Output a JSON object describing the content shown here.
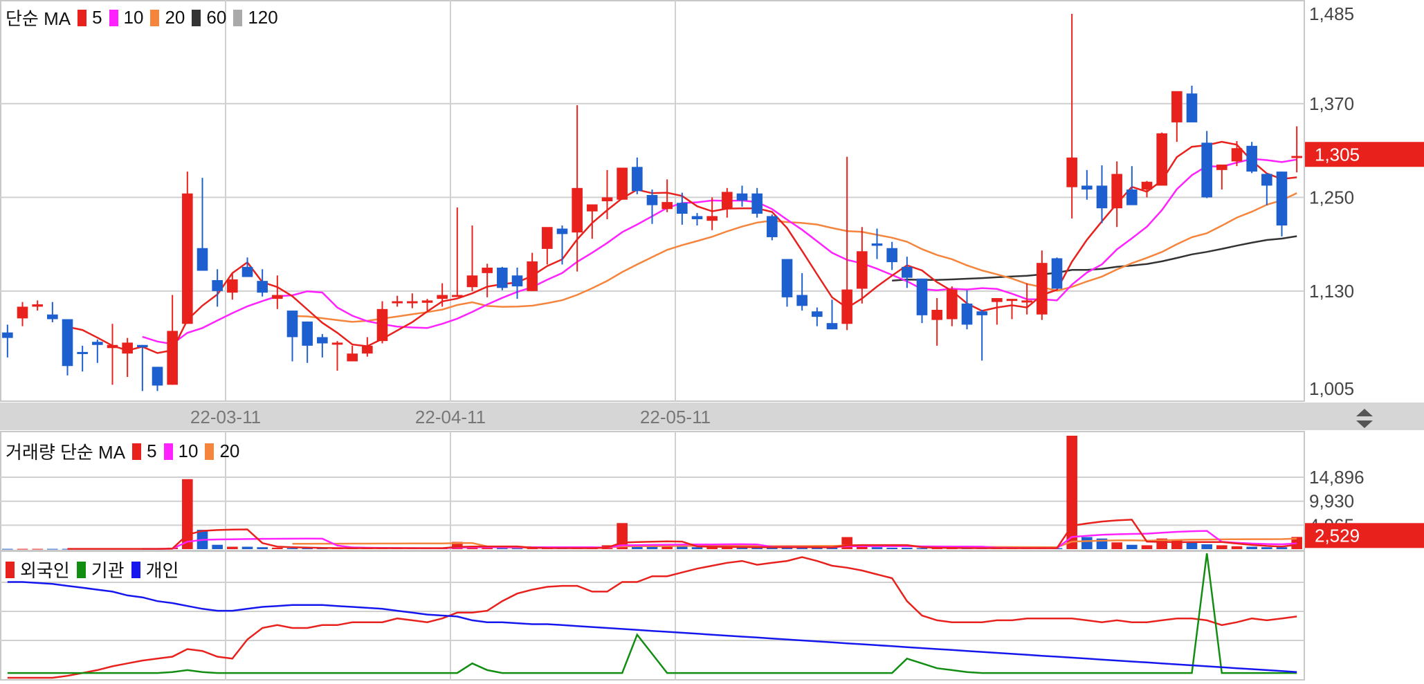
{
  "chart_data": [
    {
      "type": "candlestick",
      "legend": {
        "title": "단순 MA",
        "items": [
          {
            "label": "5",
            "color": "#e8211d"
          },
          {
            "label": "10",
            "color": "#ff22ff"
          },
          {
            "label": "20",
            "color": "#f5843c"
          },
          {
            "label": "60",
            "color": "#333333"
          },
          {
            "label": "120",
            "color": "#aaaaaa"
          }
        ]
      },
      "y_ticks": [
        "1,485",
        "1,370",
        "1,250",
        "1,130",
        "1,005"
      ],
      "ylim": [
        1005,
        1485
      ],
      "current_price": "1,305",
      "x_ticks": [
        "22-03-11",
        "22-04-11",
        "22-05-11"
      ],
      "up_color": "#e8211d",
      "down_color": "#1d5fcf",
      "candles": [
        [
          1077,
          1087,
          1045,
          1070
        ],
        [
          1095,
          1116,
          1085,
          1110
        ],
        [
          1110,
          1118,
          1105,
          1113
        ],
        [
          1100,
          1116,
          1090,
          1094
        ],
        [
          1094,
          1094,
          1022,
          1034
        ],
        [
          1052,
          1060,
          1027,
          1050
        ],
        [
          1065,
          1068,
          1038,
          1061
        ],
        [
          1057,
          1088,
          1010,
          1061
        ],
        [
          1050,
          1070,
          1020,
          1064
        ],
        [
          1061,
          1061,
          1002,
          1058
        ],
        [
          1033,
          1033,
          1002,
          1009
        ],
        [
          1010,
          1125,
          1010,
          1079
        ],
        [
          1088,
          1283,
          1088,
          1255
        ],
        [
          1185,
          1275,
          1160,
          1156
        ],
        [
          1144,
          1158,
          1110,
          1130
        ],
        [
          1128,
          1153,
          1119,
          1145
        ],
        [
          1161,
          1173,
          1150,
          1148
        ],
        [
          1143,
          1158,
          1123,
          1128
        ],
        [
          1120,
          1150,
          1107,
          1125
        ],
        [
          1105,
          1105,
          1040,
          1071
        ],
        [
          1091,
          1091,
          1038,
          1060
        ],
        [
          1071,
          1075,
          1045,
          1063
        ],
        [
          1064,
          1066,
          1028,
          1064
        ],
        [
          1040,
          1060,
          1040,
          1050
        ],
        [
          1050,
          1071,
          1046,
          1060
        ],
        [
          1066,
          1117,
          1063,
          1107
        ],
        [
          1115,
          1124,
          1110,
          1117
        ],
        [
          1115,
          1127,
          1108,
          1117
        ],
        [
          1115,
          1120,
          1105,
          1118
        ],
        [
          1120,
          1140,
          1110,
          1125
        ],
        [
          1125,
          1237,
          1125,
          1125
        ],
        [
          1135,
          1214,
          1130,
          1150
        ],
        [
          1153,
          1165,
          1122,
          1160
        ],
        [
          1160,
          1161,
          1131,
          1134
        ],
        [
          1150,
          1160,
          1120,
          1136
        ],
        [
          1130,
          1179,
          1130,
          1168
        ],
        [
          1184,
          1209,
          1164,
          1212
        ],
        [
          1210,
          1214,
          1164,
          1203
        ],
        [
          1205,
          1368,
          1155,
          1262
        ],
        [
          1232,
          1236,
          1197,
          1241
        ],
        [
          1245,
          1285,
          1222,
          1250
        ],
        [
          1247,
          1288,
          1247,
          1288
        ],
        [
          1289,
          1301,
          1254,
          1258
        ],
        [
          1253,
          1260,
          1216,
          1240
        ],
        [
          1235,
          1273,
          1231,
          1244
        ],
        [
          1243,
          1256,
          1215,
          1229
        ],
        [
          1226,
          1230,
          1214,
          1222
        ],
        [
          1220,
          1250,
          1208,
          1226
        ],
        [
          1235,
          1262,
          1224,
          1257
        ],
        [
          1255,
          1265,
          1238,
          1246
        ],
        [
          1255,
          1262,
          1224,
          1229
        ],
        [
          1226,
          1228,
          1195,
          1199
        ],
        [
          1171,
          1171,
          1110,
          1122
        ],
        [
          1125,
          1153,
          1105,
          1111
        ],
        [
          1104,
          1109,
          1085,
          1097
        ],
        [
          1089,
          1119,
          1081,
          1081
        ],
        [
          1088,
          1302,
          1080,
          1132
        ],
        [
          1133,
          1212,
          1114,
          1181
        ],
        [
          1191,
          1210,
          1171,
          1188
        ],
        [
          1185,
          1193,
          1157,
          1167
        ],
        [
          1161,
          1174,
          1134,
          1147
        ],
        [
          1146,
          1146,
          1089,
          1099
        ],
        [
          1093,
          1121,
          1060,
          1106
        ],
        [
          1094,
          1136,
          1085,
          1132
        ],
        [
          1114,
          1131,
          1081,
          1087
        ],
        [
          1104,
          1106,
          1041,
          1099
        ],
        [
          1116,
          1121,
          1087,
          1121
        ],
        [
          1120,
          1120,
          1094,
          1120
        ],
        [
          1117,
          1140,
          1100,
          1118
        ],
        [
          1100,
          1182,
          1093,
          1166
        ],
        [
          1172,
          1173,
          1137,
          1133
        ],
        [
          1263,
          1485,
          1223,
          1301
        ],
        [
          1265,
          1285,
          1247,
          1260
        ],
        [
          1265,
          1291,
          1217,
          1236
        ],
        [
          1236,
          1296,
          1212,
          1280
        ],
        [
          1260,
          1290,
          1248,
          1240
        ],
        [
          1260,
          1271,
          1250,
          1270
        ],
        [
          1265,
          1333,
          1268,
          1332
        ],
        [
          1346,
          1379,
          1321,
          1386
        ],
        [
          1383,
          1393,
          1355,
          1346
        ],
        [
          1320,
          1335,
          1249,
          1250
        ],
        [
          1285,
          1290,
          1260,
          1292
        ],
        [
          1296,
          1322,
          1290,
          1313
        ],
        [
          1316,
          1321,
          1281,
          1283
        ],
        [
          1280,
          1281,
          1240,
          1265
        ],
        [
          1283,
          1283,
          1200,
          1214
        ],
        [
          1303,
          1341,
          1282,
          1303
        ]
      ]
    },
    {
      "type": "bar",
      "legend": {
        "title": "거래량 단순 MA",
        "items": [
          {
            "label": "5",
            "color": "#e8211d"
          },
          {
            "label": "10",
            "color": "#ff22ff"
          },
          {
            "label": "20",
            "color": "#f5843c"
          }
        ]
      },
      "y_ticks": [
        "14,896",
        "9,930",
        "4,965"
      ],
      "current_volume": "2,529",
      "values": [
        60,
        60,
        60,
        60,
        60,
        60,
        60,
        60,
        60,
        60,
        60,
        300,
        14500,
        4000,
        900,
        500,
        500,
        400,
        300,
        200,
        200,
        200,
        200,
        200,
        200,
        200,
        200,
        200,
        200,
        200,
        1500,
        600,
        300,
        200,
        200,
        200,
        200,
        200,
        200,
        200,
        800,
        5400,
        700,
        600,
        600,
        500,
        400,
        400,
        400,
        400,
        400,
        400,
        400,
        400,
        300,
        300,
        2500,
        700,
        400,
        300,
        300,
        200,
        200,
        200,
        200,
        200,
        200,
        200,
        200,
        200,
        200,
        23500,
        2500,
        2200,
        1400,
        900,
        800,
        2200,
        1900,
        1500,
        1000,
        800,
        600,
        500,
        400,
        400,
        2529
      ]
    },
    {
      "type": "line",
      "legend": [
        {
          "label": "외국인",
          "color": "#e8211d"
        },
        {
          "label": "기관",
          "color": "#118d11"
        },
        {
          "label": "개인",
          "color": "#1616ee"
        }
      ],
      "series": [
        {
          "name": "외국인",
          "color": "#e8211d",
          "values": [
            0,
            0,
            0,
            0,
            2,
            5,
            8,
            12,
            15,
            18,
            20,
            22,
            30,
            28,
            22,
            20,
            40,
            52,
            55,
            52,
            52,
            55,
            55,
            58,
            58,
            58,
            62,
            60,
            58,
            62,
            68,
            68,
            70,
            80,
            88,
            92,
            95,
            96,
            96,
            90,
            90,
            100,
            100,
            106,
            106,
            110,
            114,
            117,
            120,
            122,
            118,
            120,
            122,
            126,
            122,
            117,
            115,
            112,
            108,
            104,
            80,
            65,
            60,
            58,
            58,
            58,
            60,
            60,
            62,
            62,
            62,
            62,
            60,
            58,
            60,
            58,
            58,
            60,
            62,
            62,
            60,
            55,
            58,
            62,
            60,
            62,
            64
          ]
        },
        {
          "name": "기관",
          "color": "#118d11",
          "values": [
            5,
            5,
            5,
            5,
            5,
            5,
            5,
            5,
            5,
            5,
            5,
            6,
            8,
            6,
            5,
            5,
            5,
            5,
            5,
            5,
            5,
            5,
            5,
            5,
            5,
            5,
            5,
            5,
            5,
            5,
            5,
            15,
            8,
            5,
            5,
            5,
            5,
            5,
            5,
            5,
            5,
            5,
            45,
            25,
            5,
            5,
            5,
            5,
            5,
            5,
            5,
            5,
            5,
            5,
            5,
            5,
            5,
            5,
            5,
            5,
            20,
            15,
            10,
            8,
            6,
            5,
            5,
            5,
            5,
            5,
            5,
            5,
            5,
            5,
            5,
            5,
            5,
            5,
            5,
            5,
            130,
            5,
            5,
            5,
            5,
            5,
            5
          ]
        },
        {
          "name": "개인",
          "color": "#1616ee",
          "values": [
            100,
            100,
            99,
            98,
            96,
            94,
            92,
            90,
            86,
            84,
            80,
            78,
            75,
            72,
            70,
            70,
            72,
            74,
            75,
            76,
            76,
            76,
            75,
            74,
            73,
            72,
            70,
            68,
            66,
            65,
            64,
            60,
            58,
            58,
            57,
            56,
            56,
            55,
            54,
            53,
            52,
            51,
            50,
            49,
            48,
            47,
            46,
            45,
            44,
            43,
            42,
            41,
            40,
            39,
            38,
            37,
            36,
            35,
            34,
            33,
            32,
            31,
            30,
            29,
            28,
            27,
            26,
            25,
            24,
            23,
            22,
            21,
            20,
            19,
            18,
            17,
            16,
            15,
            14,
            13,
            12,
            11,
            10,
            9,
            8,
            7,
            6
          ]
        }
      ]
    }
  ]
}
